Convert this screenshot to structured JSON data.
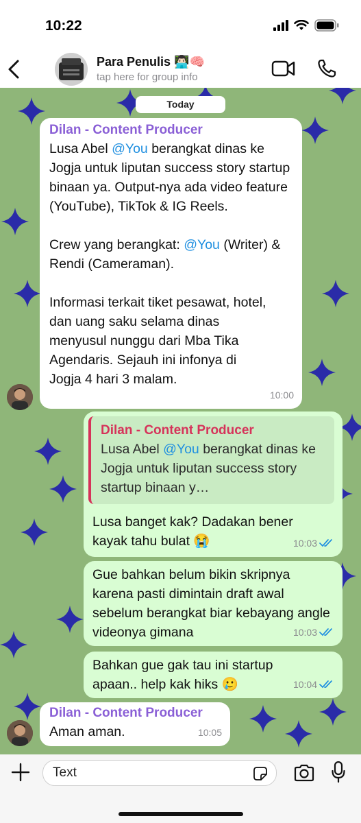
{
  "status_bar": {
    "time": "10:22"
  },
  "header": {
    "title": "Para Penulis 👨🏻‍💻🧠",
    "subtitle": "tap here for group info"
  },
  "chat": {
    "date_label": "Today",
    "messages": [
      {
        "sender": "Dilan - Content Producer",
        "p1_a": "Lusa Abel ",
        "p1_mention": "@You",
        "p1_b": " berangkat dinas ke Jogja untuk liputan success story startup binaan ya. Output-nya ada video feature (YouTube), TikTok & IG Reels.",
        "p2_a": "Crew yang berangkat: ",
        "p2_mention": "@You",
        "p2_b": " (Writer) & Rendi (Cameraman).",
        "p3": "Informasi terkait tiket pesawat, hotel, dan uang saku selama dinas menyusul nunggu dari Mba Tika Agendaris. Sejauh ini infonya di Jogja 4 hari 3 malam.",
        "time": "10:00"
      },
      {
        "quote_sender": "Dilan - Content Producer",
        "quote_a": "Lusa Abel ",
        "quote_mention": "@You",
        "quote_b": " berangkat dinas ke Jogja untuk liputan success story startup binaan y…",
        "text": "Lusa banget kak? Dadakan bener kayak tahu bulat 😭",
        "time": "10:03"
      },
      {
        "text": "Gue bahkan belum bikin skripnya karena pasti dimintain draft awal sebelum berangkat biar kebayang angle videonya gimana",
        "time": "10:03"
      },
      {
        "text": "Bahkan gue gak tau ini startup apaan.. help kak hiks 🥲",
        "time": "10:04"
      },
      {
        "sender": "Dilan - Content Producer",
        "text": "Aman aman.",
        "time": "10:05"
      }
    ]
  },
  "input_bar": {
    "placeholder": "Text"
  },
  "colors": {
    "wallpaper": "#8fb679",
    "star": "#2a2ba8",
    "outgoing_bubble": "#d9fdd3",
    "sender_name": "#8a5fd6",
    "quote_accent": "#d6335a",
    "mention": "#1f8fe0"
  },
  "icons": [
    "back-chevron-icon",
    "video-call-icon",
    "phone-icon",
    "plus-icon",
    "sticker-icon",
    "camera-icon",
    "microphone-icon",
    "read-receipt-icon"
  ]
}
